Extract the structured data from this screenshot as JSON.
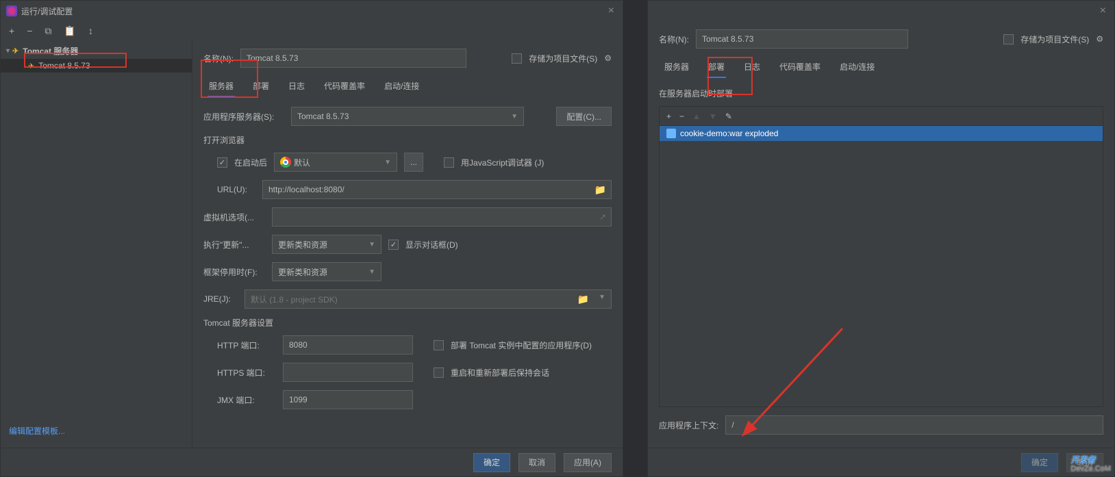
{
  "leftDialog": {
    "title": "运行/调试配置",
    "toolbar": {
      "add": "+",
      "remove": "−",
      "copy": "⧉",
      "save": "📋",
      "sort": "↕"
    },
    "tree": {
      "group": "Tomcat 服务器",
      "item": "Tomcat 8.5.73"
    },
    "nameLabel": "名称(N):",
    "nameValue": "Tomcat 8.5.73",
    "storeAsFile": "存储为项目文件(S)",
    "tabs": [
      "服务器",
      "部署",
      "日志",
      "代码覆盖率",
      "启动/连接"
    ],
    "appServerLabel": "应用程序服务器(S):",
    "appServerValue": "Tomcat 8.5.73",
    "configureBtn": "配置(C)...",
    "openBrowser": "打开浏览器",
    "afterLaunch": "在启动后",
    "browserDefault": "默认",
    "useJsDebugger": "用JavaScript调试器 (J)",
    "urlLabel": "URL(U):",
    "urlValue": "http://localhost:8080/",
    "vmOptionsLabel": "虚拟机选项(...",
    "onUpdateLabel": "执行\"更新\"...",
    "onUpdateValue": "更新类和资源",
    "showDialog": "显示对话框(D)",
    "onFrameLabel": "框架停用时(F):",
    "onFrameValue": "更新类和资源",
    "jreLabel": "JRE(J):",
    "jreValue": "默认 (1.8 - project SDK)",
    "tomcatSettings": "Tomcat 服务器设置",
    "httpPortLabel": "HTTP 端口:",
    "httpPortValue": "8080",
    "deployInInstance": "部署 Tomcat 实例中配置的应用程序(D)",
    "httpsPortLabel": "HTTPS 端口:",
    "preserveSessions": "重启和重新部署后保持会话",
    "jmxPortLabel": "JMX 端口:",
    "jmxPortValue": "1099",
    "editTemplate": "编辑配置模板...",
    "okBtn": "确定",
    "cancelBtn": "取消",
    "applyBtn": "应用(A)"
  },
  "rightDialog": {
    "nameLabel": "名称(N):",
    "nameValue": "Tomcat 8.5.73",
    "storeAsFile": "存储为项目文件(S)",
    "tabs": [
      "服务器",
      "部署",
      "日志",
      "代码覆盖率",
      "启动/连接"
    ],
    "deployOnStart": "在服务器启动时部署",
    "artifact": "cookie-demo:war exploded",
    "contextLabel": "应用程序上下文:",
    "contextValue": "/",
    "okBtn": "确定",
    "cancelBtn": "取消"
  },
  "watermark": {
    "main": "开发者",
    "sub": "DevZe.CoM"
  }
}
